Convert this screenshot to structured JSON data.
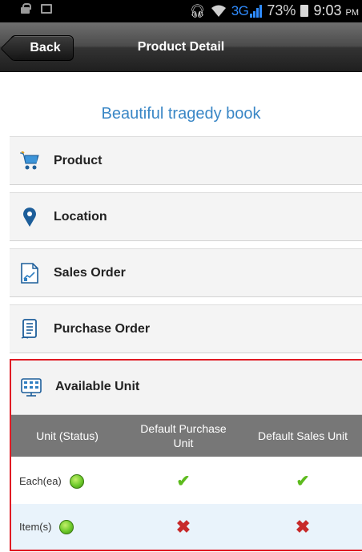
{
  "status_bar": {
    "carrier_network": "3G",
    "battery_percent": "73%",
    "time": "9:03",
    "ampm": "PM"
  },
  "nav": {
    "back_label": "Back",
    "title": "Product Detail"
  },
  "book_title": "Beautiful tragedy book",
  "menu_items": [
    {
      "label": "Product",
      "icon": "cart-icon"
    },
    {
      "label": "Location",
      "icon": "map-pin-icon"
    },
    {
      "label": "Sales Order",
      "icon": "sales-document-icon"
    },
    {
      "label": "Purchase Order",
      "icon": "purchase-list-icon"
    }
  ],
  "available_unit": {
    "label": "Available Unit",
    "icon": "unit-grid-icon",
    "columns": [
      "Unit (Status)",
      "Default Purchase Unit",
      "Default Sales Unit"
    ],
    "rows": [
      {
        "unit": "Each(ea)",
        "status": "active",
        "default_purchase": true,
        "default_sales": true
      },
      {
        "unit": "Item(s)",
        "status": "active",
        "default_purchase": false,
        "default_sales": false
      }
    ]
  },
  "colors": {
    "accent_title": "#3a87c6",
    "highlight_border": "#e01b24",
    "table_header": "#777777",
    "check": "#5dbb1e",
    "cross": "#c72a2a"
  }
}
